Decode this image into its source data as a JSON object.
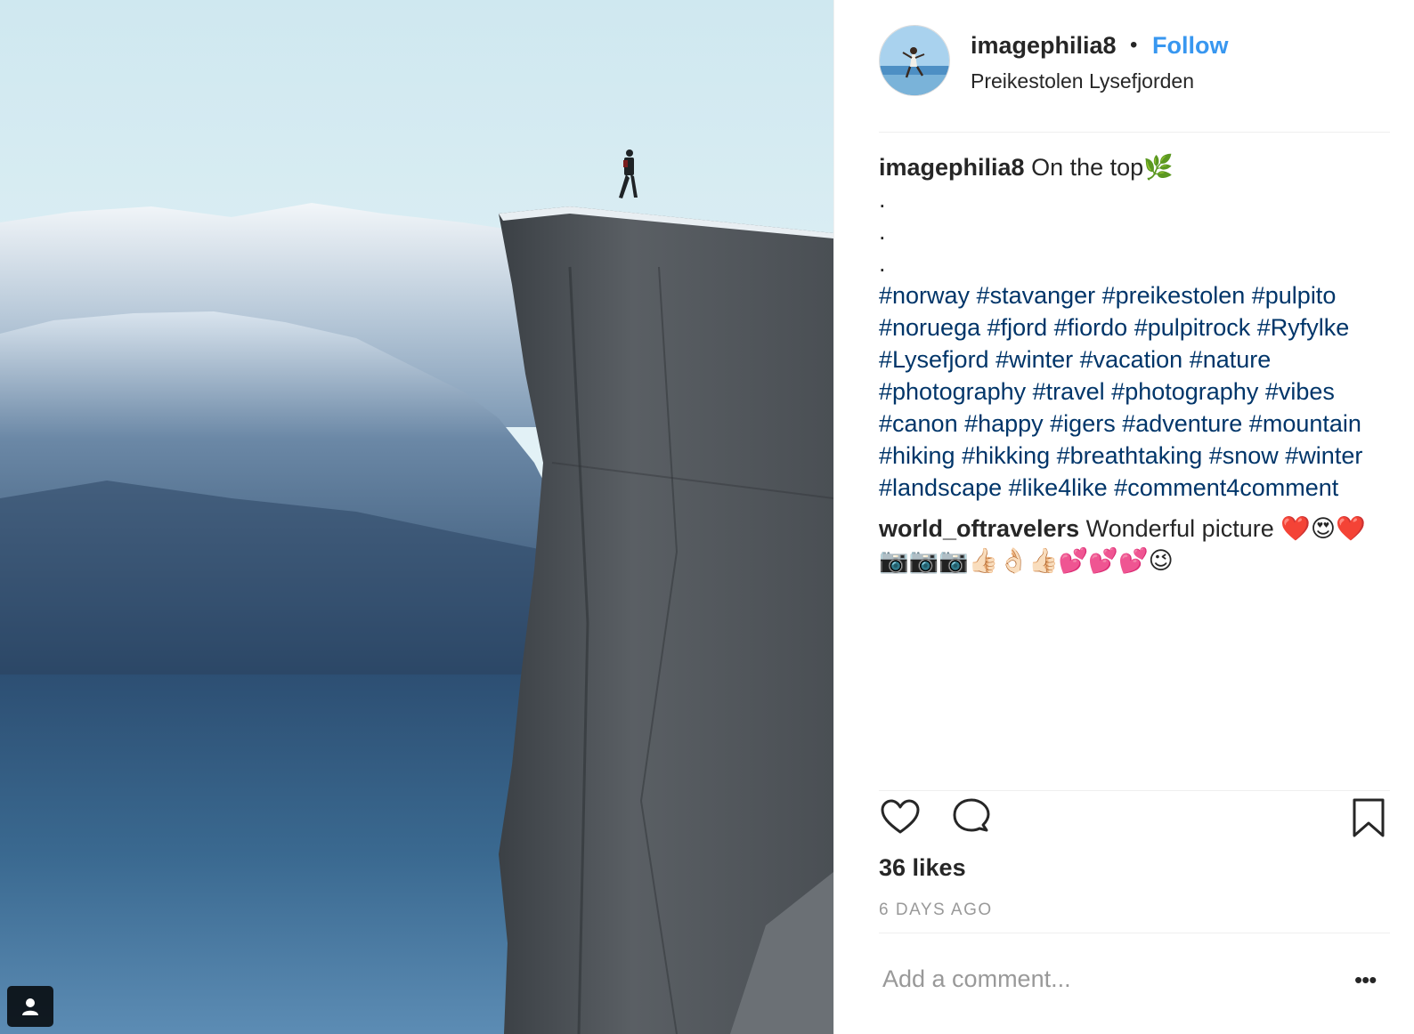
{
  "post": {
    "username": "imagephilia8",
    "separator": "•",
    "follow_label": "Follow",
    "location": "Preikestolen Lysefjorden",
    "caption": {
      "username": "imagephilia8",
      "text": "On the top🌿",
      "dot_lines": [
        ".",
        ".",
        "."
      ],
      "hashtags": "#norway #stavanger #preikestolen #pulpito #noruega #fjord #fiordo #pulpitrock #Ryfylke #Lysefjord #winter #vacation #nature #photography #travel #photography #vibes #canon #happy #igers #adventure #mountain #hiking #hikking #breathtaking #snow #winter #landscape #like4like #comment4comment"
    },
    "comment": {
      "username": "world_oftravelers",
      "text": "Wonderful picture ❤️😍❤️📷📷📷👍🏻👌🏻👍🏻💕💕💕😉"
    },
    "likes": "36 likes",
    "timestamp": "6 DAYS AGO",
    "add_comment_placeholder": "Add a comment...",
    "more_label": "•••"
  },
  "icons": {
    "like": "heart-icon",
    "comment": "comment-bubble-icon",
    "save": "bookmark-icon",
    "tag": "user-tag-icon"
  },
  "colors": {
    "link": "#3897f0",
    "hashtag": "#003569",
    "muted": "#999999"
  }
}
